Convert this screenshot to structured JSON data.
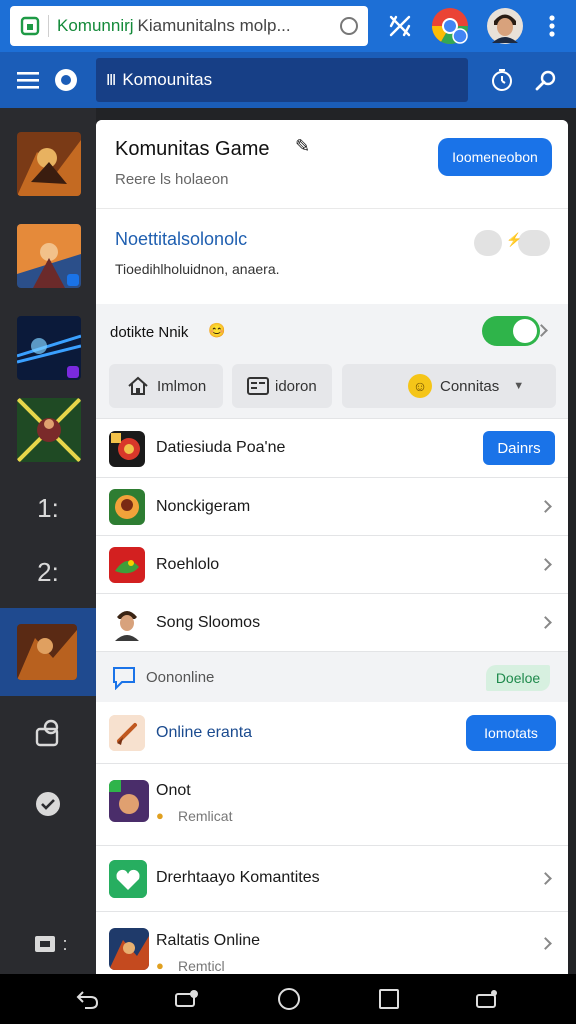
{
  "browser": {
    "url_site": "Komunnirj",
    "url_path": "Kiamunitalns molp...",
    "icons": [
      "lock-icon",
      "reload-icon",
      "extensions-icon",
      "profile-chrome-icon",
      "avatar",
      "more-vert-icon"
    ]
  },
  "app_bar": {
    "title": "Komounitas",
    "icons": [
      "menu-icon",
      "app-logo-icon",
      "timer-icon",
      "search-icon"
    ]
  },
  "rail": {
    "counter_a": "1:",
    "counter_b": "2:",
    "counter_c": ":"
  },
  "header": {
    "title": "Komunitas Game",
    "subtitle": "Reere ls holaeon",
    "action": "Ioomeneobon"
  },
  "notification": {
    "title": "Noettitalsolonolc",
    "desc": "Tioedihlholuidnon, anaera."
  },
  "mode": {
    "label": "dotikte Nnik"
  },
  "chips": [
    {
      "label": "Imlmon",
      "icon": "home-icon"
    },
    {
      "label": "idoron",
      "icon": "list-icon"
    },
    {
      "label": "Connitas",
      "icon": "emoji-icon"
    }
  ],
  "list": [
    {
      "title": "Datiesiuda Poa'ne",
      "action": "Dainrs"
    },
    {
      "title": "Nonckigeram"
    },
    {
      "title": "Roehlolo"
    },
    {
      "title": "Song Sloomos"
    }
  ],
  "online_section": {
    "label": "Oononline",
    "badge": "Doeloe"
  },
  "online_group": {
    "title": "Online eranta",
    "action": "Iomotats"
  },
  "entries": [
    {
      "title": "Onot",
      "subtitle": "Remlicat"
    },
    {
      "title": "Drerhtaayo Komantites"
    },
    {
      "title": "Raltatis Online",
      "subtitle": "Remticl"
    }
  ],
  "colors": {
    "browser_bar": "#1d6fd6",
    "app_bar": "#1b5db8",
    "accent": "#1a73e8",
    "toggle_on": "#2fb44a",
    "rail": "#2a2b2f"
  }
}
